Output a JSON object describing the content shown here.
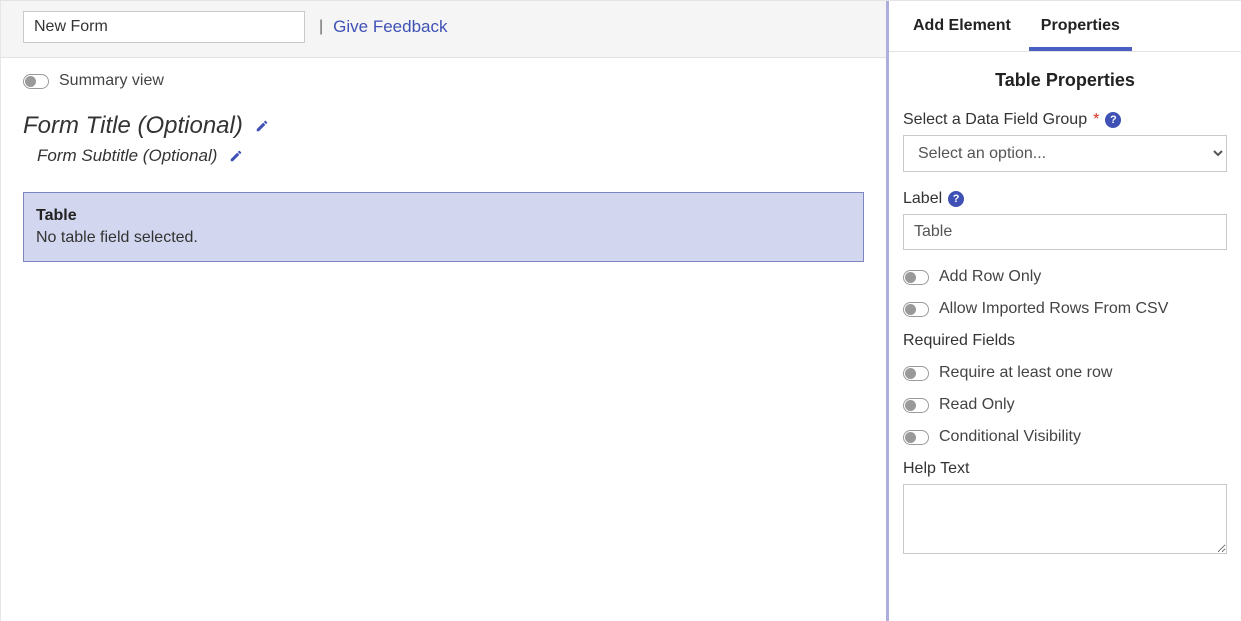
{
  "topbar": {
    "form_name": "New Form",
    "divider": "|",
    "feedback": "Give Feedback"
  },
  "canvas": {
    "summary_view_label": "Summary view",
    "form_title_placeholder": "Form Title (Optional)",
    "form_subtitle_placeholder": "Form Subtitle (Optional)",
    "table_block": {
      "title": "Table",
      "message": "No table field selected."
    }
  },
  "side": {
    "tabs": {
      "add_element": "Add Element",
      "properties": "Properties"
    },
    "panel_title": "Table Properties",
    "data_field_group": {
      "label": "Select a Data Field Group",
      "placeholder": "Select an option..."
    },
    "label_field": {
      "label": "Label",
      "value": "Table"
    },
    "options": {
      "add_row_only": "Add Row Only",
      "allow_csv": "Allow Imported Rows From CSV",
      "required_fields_header": "Required Fields",
      "require_one_row": "Require at least one row",
      "read_only": "Read Only",
      "conditional_visibility": "Conditional Visibility"
    },
    "help_text_label": "Help Text"
  }
}
